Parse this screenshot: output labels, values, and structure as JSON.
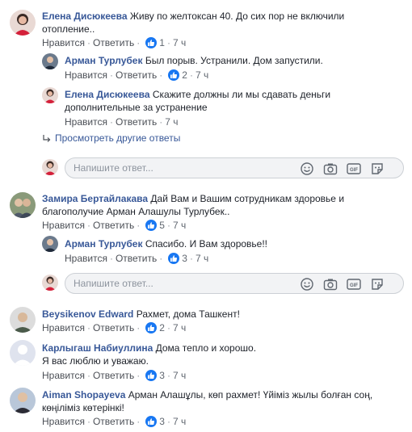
{
  "comments": [
    {
      "author": "Елена Дисюкеева",
      "text1": "Живу по желтоксан 40. До сих пор не включили",
      "text2": "отопление..",
      "like": "Нравится",
      "reply": "Ответить",
      "count": "1",
      "time": "7 ч"
    },
    {
      "author": "Арман Турлубек",
      "text1": "Был порыв. Устранили. Дом запустили.",
      "like": "Нравится",
      "reply": "Ответить",
      "count": "2",
      "time": "7 ч"
    },
    {
      "author": "Елена Дисюкеева",
      "text1": "Скажите должны ли мы сдавать деньги",
      "text2": "дополнительные за устранение",
      "like": "Нравится",
      "reply": "Ответить",
      "time": "7 ч"
    },
    {
      "author": "Замира Бертайлакава",
      "text1": "Дай Вам и Вашим сотрудникам здоровье и",
      "text2": "благополучие Арман Алашулы Турлубек..",
      "like": "Нравится",
      "reply": "Ответить",
      "count": "5",
      "time": "7 ч"
    },
    {
      "author": "Арман Турлубек",
      "text1": "Спасибо. И Вам здоровье!!",
      "like": "Нравится",
      "reply": "Ответить",
      "count": "3",
      "time": "7 ч"
    },
    {
      "author": "Beysikenov Edward",
      "text1": "Рахмет, дома Ташкент!",
      "like": "Нравится",
      "reply": "Ответить",
      "count": "2",
      "time": "7 ч"
    },
    {
      "author": "Карлыгаш Набиуллина",
      "text1": "Дома тепло и хорошо.",
      "text2": "Я вас люблю и уважаю.",
      "like": "Нравится",
      "reply": "Ответить",
      "count": "3",
      "time": "7 ч"
    },
    {
      "author": "Aiman Shopayeva",
      "text1": "Арман Алашұлы, көп рахмет! Үйіміз жылы болған соң,",
      "text2": "көңіліміз көтерінкі!",
      "like": "Нравится",
      "reply": "Ответить",
      "count": "3",
      "time": "7 ч"
    }
  ],
  "more_replies": "Просмотреть другие ответы",
  "reply_placeholder": "Напишите ответ...",
  "gif_label": "GIF",
  "colors": {
    "link": "#385898",
    "like": "#1877f2",
    "meta": "#606770"
  }
}
